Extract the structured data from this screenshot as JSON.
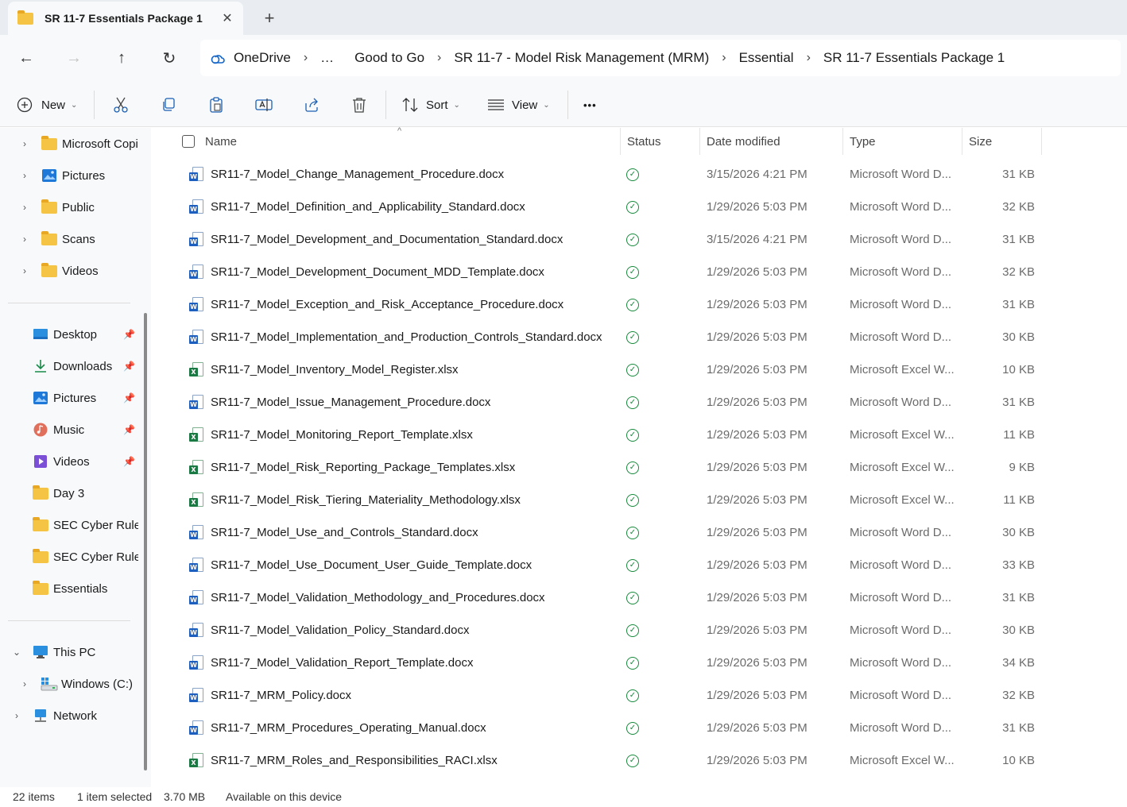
{
  "tab": {
    "title": "SR 11-7 Essentials Package 1",
    "close_glyph": "✕",
    "new_glyph": "+"
  },
  "nav": {
    "back": "←",
    "forward": "→",
    "up": "↑",
    "refresh": "↻"
  },
  "breadcrumb": {
    "items": [
      "OneDrive",
      "…",
      "Good to Go",
      "SR 11-7 - Model Risk Management (MRM)",
      "Essential",
      "SR 11-7 Essentials Package 1"
    ],
    "separator": "›"
  },
  "toolbar": {
    "new_label": "New",
    "sort_label": "Sort",
    "view_label": "View",
    "more_label": "•••"
  },
  "sidebar": {
    "tree_top": [
      {
        "label": "Microsoft Copi",
        "icon": "folder-icon"
      },
      {
        "label": "Pictures",
        "icon": "pictures-icon"
      },
      {
        "label": "Public",
        "icon": "folder-icon"
      },
      {
        "label": "Scans",
        "icon": "folder-icon"
      },
      {
        "label": "Videos",
        "icon": "folder-icon"
      }
    ],
    "quick_access": [
      {
        "label": "Desktop",
        "icon": "desktop-icon",
        "pinned": true
      },
      {
        "label": "Downloads",
        "icon": "download-icon",
        "pinned": true
      },
      {
        "label": "Pictures",
        "icon": "pictures-icon",
        "pinned": true
      },
      {
        "label": "Music",
        "icon": "music-icon",
        "pinned": true
      },
      {
        "label": "Videos",
        "icon": "videos-icon",
        "pinned": true
      },
      {
        "label": "Day 3",
        "icon": "folder-icon",
        "pinned": false
      },
      {
        "label": "SEC Cyber Rules",
        "icon": "folder-icon",
        "pinned": false
      },
      {
        "label": "SEC Cyber Rules",
        "icon": "folder-icon",
        "pinned": false
      },
      {
        "label": "Essentials",
        "icon": "folder-icon",
        "pinned": false
      }
    ],
    "this_pc": "This PC",
    "windows_c": "Windows (C:)",
    "network": "Network"
  },
  "columns": {
    "name": "Name",
    "status": "Status",
    "date": "Date modified",
    "type": "Type",
    "size": "Size"
  },
  "files": [
    {
      "name": "SR11-7_Model_Change_Management_Procedure.docx",
      "kind": "word",
      "date": "3/15/2026 4:21 PM",
      "type": "Microsoft Word D...",
      "size": "31 KB"
    },
    {
      "name": "SR11-7_Model_Definition_and_Applicability_Standard.docx",
      "kind": "word",
      "date": "1/29/2026 5:03 PM",
      "type": "Microsoft Word D...",
      "size": "32 KB"
    },
    {
      "name": "SR11-7_Model_Development_and_Documentation_Standard.docx",
      "kind": "word",
      "date": "3/15/2026 4:21 PM",
      "type": "Microsoft Word D...",
      "size": "31 KB"
    },
    {
      "name": "SR11-7_Model_Development_Document_MDD_Template.docx",
      "kind": "word",
      "date": "1/29/2026 5:03 PM",
      "type": "Microsoft Word D...",
      "size": "32 KB"
    },
    {
      "name": "SR11-7_Model_Exception_and_Risk_Acceptance_Procedure.docx",
      "kind": "word",
      "date": "1/29/2026 5:03 PM",
      "type": "Microsoft Word D...",
      "size": "31 KB"
    },
    {
      "name": "SR11-7_Model_Implementation_and_Production_Controls_Standard.docx",
      "kind": "word",
      "date": "1/29/2026 5:03 PM",
      "type": "Microsoft Word D...",
      "size": "30 KB"
    },
    {
      "name": "SR11-7_Model_Inventory_Model_Register.xlsx",
      "kind": "excel",
      "date": "1/29/2026 5:03 PM",
      "type": "Microsoft Excel W...",
      "size": "10 KB"
    },
    {
      "name": "SR11-7_Model_Issue_Management_Procedure.docx",
      "kind": "word",
      "date": "1/29/2026 5:03 PM",
      "type": "Microsoft Word D...",
      "size": "31 KB"
    },
    {
      "name": "SR11-7_Model_Monitoring_Report_Template.xlsx",
      "kind": "excel",
      "date": "1/29/2026 5:03 PM",
      "type": "Microsoft Excel W...",
      "size": "11 KB"
    },
    {
      "name": "SR11-7_Model_Risk_Reporting_Package_Templates.xlsx",
      "kind": "excel",
      "date": "1/29/2026 5:03 PM",
      "type": "Microsoft Excel W...",
      "size": "9 KB"
    },
    {
      "name": "SR11-7_Model_Risk_Tiering_Materiality_Methodology.xlsx",
      "kind": "excel",
      "date": "1/29/2026 5:03 PM",
      "type": "Microsoft Excel W...",
      "size": "11 KB"
    },
    {
      "name": "SR11-7_Model_Use_and_Controls_Standard.docx",
      "kind": "word",
      "date": "1/29/2026 5:03 PM",
      "type": "Microsoft Word D...",
      "size": "30 KB"
    },
    {
      "name": "SR11-7_Model_Use_Document_User_Guide_Template.docx",
      "kind": "word",
      "date": "1/29/2026 5:03 PM",
      "type": "Microsoft Word D...",
      "size": "33 KB"
    },
    {
      "name": "SR11-7_Model_Validation_Methodology_and_Procedures.docx",
      "kind": "word",
      "date": "1/29/2026 5:03 PM",
      "type": "Microsoft Word D...",
      "size": "31 KB"
    },
    {
      "name": "SR11-7_Model_Validation_Policy_Standard.docx",
      "kind": "word",
      "date": "1/29/2026 5:03 PM",
      "type": "Microsoft Word D...",
      "size": "30 KB"
    },
    {
      "name": "SR11-7_Model_Validation_Report_Template.docx",
      "kind": "word",
      "date": "1/29/2026 5:03 PM",
      "type": "Microsoft Word D...",
      "size": "34 KB"
    },
    {
      "name": "SR11-7_MRM_Policy.docx",
      "kind": "word",
      "date": "1/29/2026 5:03 PM",
      "type": "Microsoft Word D...",
      "size": "32 KB"
    },
    {
      "name": "SR11-7_MRM_Procedures_Operating_Manual.docx",
      "kind": "word",
      "date": "1/29/2026 5:03 PM",
      "type": "Microsoft Word D...",
      "size": "31 KB"
    },
    {
      "name": "SR11-7_MRM_Roles_and_Responsibilities_RACI.xlsx",
      "kind": "excel",
      "date": "1/29/2026 5:03 PM",
      "type": "Microsoft Excel W...",
      "size": "10 KB"
    }
  ],
  "statusbar": {
    "count": "22 items",
    "selected": "1 item selected",
    "selected_size": "3.70 MB",
    "availability": "Available on this device"
  },
  "colors": {
    "folder": "#f6c445",
    "word": "#1d5fbf",
    "excel": "#1b7a43",
    "ok": "#178a3c"
  }
}
